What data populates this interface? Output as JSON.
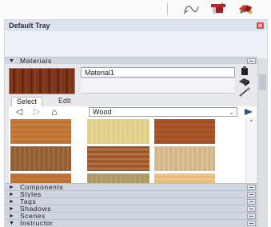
{
  "toolbar": {
    "icons": [
      "measure-tape-icon",
      "red-tools-icon",
      "paint-mixer-icon"
    ]
  },
  "tray": {
    "title": "Default Tray"
  },
  "materials": {
    "header_label": "Materials",
    "material_name": "Material1",
    "tabs": [
      "Select",
      "Edit"
    ],
    "collection": "Wood",
    "swatches": [
      {
        "name": "wood-swatch-1",
        "color_a": "#c9803f",
        "color_b": "#b96f33"
      },
      {
        "name": "wood-swatch-2",
        "color_a": "#e7d796",
        "color_b": "#dccb84"
      },
      {
        "name": "wood-swatch-3",
        "color_a": "#b05a2c",
        "color_b": "#9e4d24"
      },
      {
        "name": "wood-swatch-4",
        "color_a": "#a56d3c",
        "color_b": "#8c5a31"
      },
      {
        "name": "wood-swatch-5",
        "color_a": "#8d4a22",
        "color_b": "#c07a48"
      },
      {
        "name": "wood-swatch-6",
        "color_a": "#dcc49a",
        "color_b": "#cfb285"
      },
      {
        "name": "wood-swatch-7",
        "color_a": "#c77a3c",
        "color_b": "#b96c31"
      },
      {
        "name": "wood-swatch-8",
        "color_a": "#b9a56f",
        "color_b": "#a89460"
      },
      {
        "name": "wood-swatch-9",
        "color_a": "#efc98c",
        "color_b": "#e4b97a"
      }
    ]
  },
  "sections": [
    {
      "label": "Components",
      "expanded": false
    },
    {
      "label": "Styles",
      "expanded": false
    },
    {
      "label": "Tags",
      "expanded": false
    },
    {
      "label": "Shadows",
      "expanded": false
    },
    {
      "label": "Scenes",
      "expanded": false
    },
    {
      "label": "Instructor",
      "expanded": true
    }
  ],
  "glyphs": {
    "collapsed": "►",
    "expanded": "▼",
    "back": "◁",
    "forward": "▷",
    "home": "⌂",
    "dropdown": "⌄",
    "scroll_up": "⌃",
    "scroll_down": "⌄"
  }
}
